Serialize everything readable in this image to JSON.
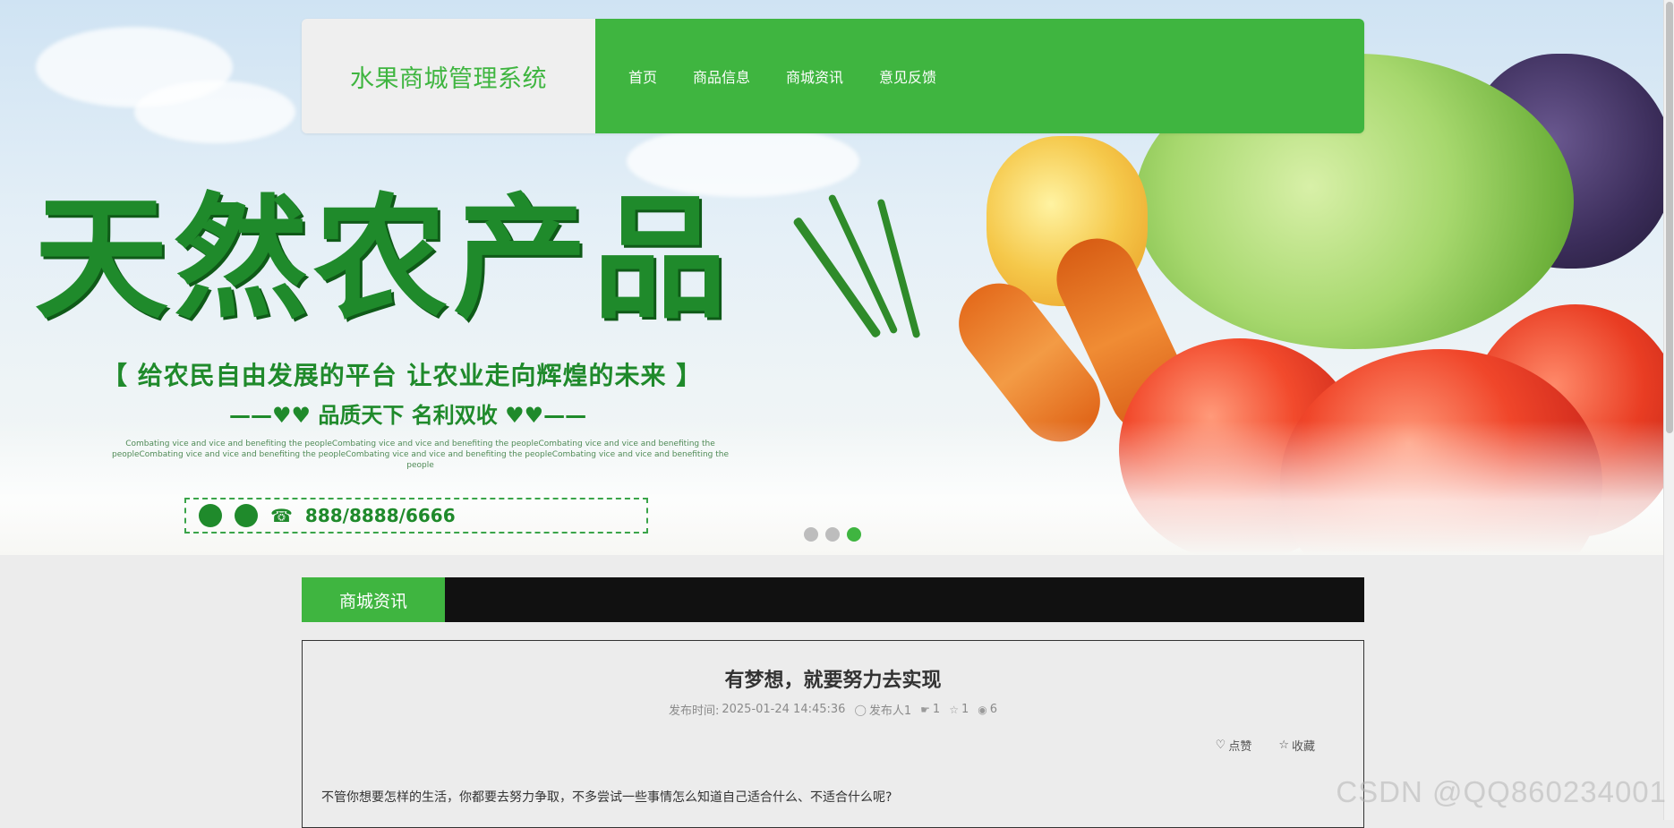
{
  "header": {
    "brand_title": "水果商城管理系统",
    "nav": [
      "首页",
      "商品信息",
      "商城资讯",
      "意见反馈"
    ]
  },
  "banner": {
    "headline": "天然农产品",
    "slogan": "【 给农民自由发展的平台  让农业走向辉煌的未来 】",
    "sub_slogan": "——♥♥ 品质天下  名利双收 ♥♥——",
    "fine_print": "Combating vice and vice and benefiting the peopleCombating vice and vice and benefiting the peopleCombating vice and vice and benefiting the peopleCombating vice and vice and benefiting the peopleCombating vice and vice and benefiting the peopleCombating vice and vice and benefiting the people",
    "phone": "888/8888/6666",
    "slides": 3,
    "active_slide": 3
  },
  "section": {
    "title": "商城资讯"
  },
  "article": {
    "title": "有梦想，就要努力去实现",
    "publish_label": "发布时间:",
    "publish_time": "2025-01-24 14:45:36",
    "author": "发布人1",
    "likes": "1",
    "favorites": "1",
    "views": "6",
    "like_label": "点赞",
    "favorite_label": "收藏",
    "body": "不管你想要怎样的生活，你都要去努力争取，不多尝试一些事情怎么知道自己适合什么、不适合什么呢?"
  },
  "watermark": "CSDN @QQ860234001",
  "colors": {
    "primary": "#3fb540",
    "section_bar": "#111111",
    "background": "#ececec"
  },
  "icons": {
    "author": "user-icon",
    "likes": "thumbs-up-icon",
    "favorites": "star-icon",
    "views": "eye-icon",
    "like_action": "heart-icon",
    "favorite_action": "star-icon"
  }
}
